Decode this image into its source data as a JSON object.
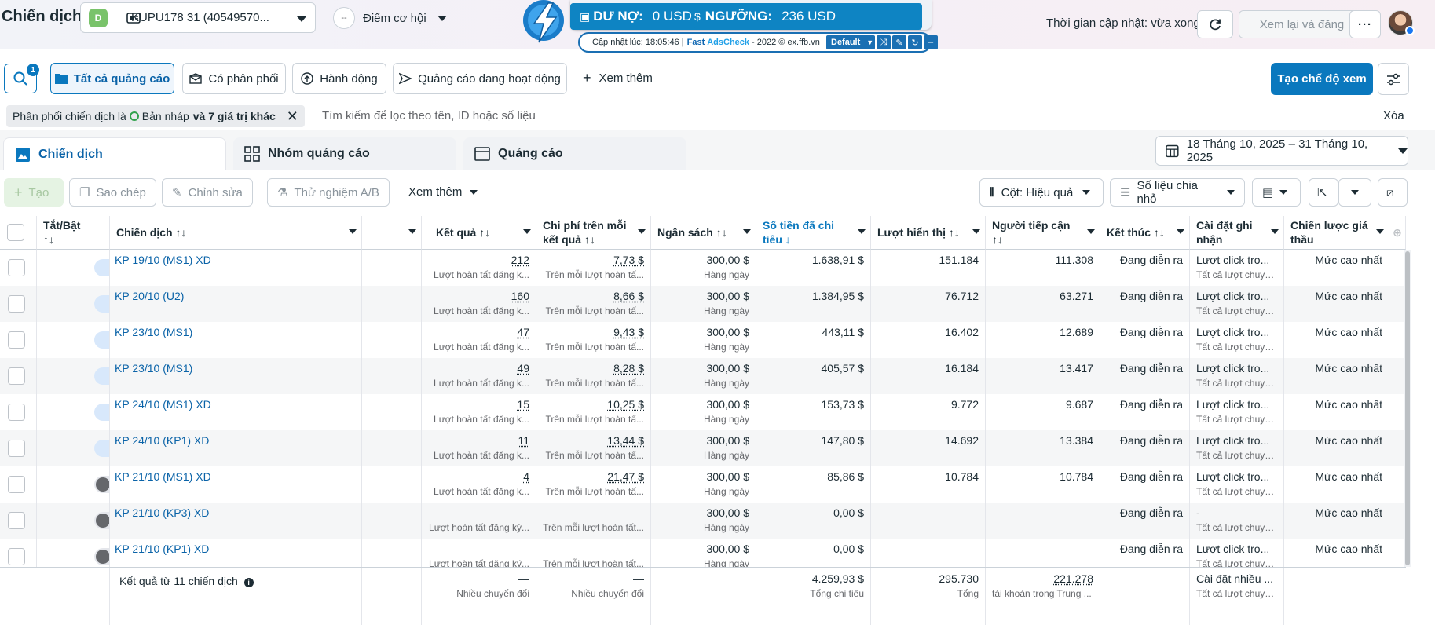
{
  "header": {
    "page_title": "Chiến dịch",
    "account_badge": "D",
    "account_name": "KUPU178 31 (40549570...",
    "opportunity_score": "--",
    "opportunity_label": "Điểm cơ hội",
    "update_status": "Thời gian cập nhật: vừa xong",
    "review_publish": "Xem lại và đăng",
    "more": "···"
  },
  "extension": {
    "debt_label": "DƯ NỢ:",
    "debt_value": "0 USD",
    "threshold_label": "NGƯỠNG:",
    "threshold_value": "236 USD",
    "updated_at": "Cập nhật lúc: 18:05:46 |",
    "brand_fast": "Fast",
    "brand_check": "AdsCheck",
    "credit": "- 2022 © ex.ffb.vn",
    "profile": "Default"
  },
  "toolbar1": {
    "search_count": "1",
    "all_ads": "Tất cả quảng cáo",
    "has_delivery": "Có phân phối",
    "actions": "Hành động",
    "active_ads": "Quảng cáo đang hoạt động",
    "see_more": "Xem thêm",
    "create_view": "Tạo chế độ xem"
  },
  "filter": {
    "chip_prefix": "Phân phối chiến dịch là",
    "chip_value": "Bản nháp",
    "chip_more": "và 7 giá trị khác",
    "search_placeholder": "Tìm kiếm để lọc theo tên, ID hoặc số liệu",
    "clear": "Xóa"
  },
  "tabs": {
    "campaigns": "Chiến dịch",
    "adsets": "Nhóm quảng cáo",
    "ads": "Quảng cáo",
    "date_range": "18 Tháng 10, 2025 – 31 Tháng 10, 2025"
  },
  "toolbar2": {
    "create": "Tạo",
    "duplicate": "Sao chép",
    "edit": "Chỉnh sửa",
    "ab_test": "Thử nghiệm A/B",
    "see_more": "Xem thêm",
    "columns": "Cột: Hiệu quả",
    "breakdown": "Số liệu chia nhỏ"
  },
  "columns": {
    "toggle": "Tắt/Bật",
    "toggle_sort": "↑↓",
    "campaign": "Chiến dịch ↑↓",
    "results": "Kết quả ↑↓",
    "cost_per_result": "Chi phí trên mỗi",
    "cost_per_result2": "kết quả ↑↓",
    "budget": "Ngân sách ↑↓",
    "spent": "Số tiền đã chi",
    "spent2": "tiêu ↓",
    "impressions": "Lượt hiển thị ↑↓",
    "reach": "Người tiếp cận",
    "reach2": "↑↓",
    "ends": "Kết thúc ↑↓",
    "attribution": "Cài đặt ghi",
    "attribution2": "nhận",
    "bid_strategy": "Chiến lược giá",
    "bid_strategy2": "thầu"
  },
  "rows": [
    {
      "on": true,
      "name": "KP 19/10 (MS1) XD",
      "results": "212",
      "results_sub": "Lượt hoàn tất đăng k...",
      "cpr": "7,73 $",
      "cpr_sub": "Trên mỗi lượt hoàn tấ...",
      "budget": "300,00 $",
      "budget_sub": "Hàng ngày",
      "spent": "1.638,91 $",
      "impr": "151.184",
      "reach": "111.308",
      "ends": "Đang diễn ra",
      "attr": "Lượt click tro...",
      "attr_sub": "Tất cả lượt chuyể...",
      "bid": "Mức cao nhất"
    },
    {
      "on": true,
      "name": "KP 20/10 (U2)",
      "results": "160",
      "results_sub": "Lượt hoàn tất đăng k...",
      "cpr": "8,66 $",
      "cpr_sub": "Trên mỗi lượt hoàn tấ...",
      "budget": "300,00 $",
      "budget_sub": "Hàng ngày",
      "spent": "1.384,95 $",
      "impr": "76.712",
      "reach": "63.271",
      "ends": "Đang diễn ra",
      "attr": "Lượt click tro...",
      "attr_sub": "Tất cả lượt chuyể...",
      "bid": "Mức cao nhất"
    },
    {
      "on": true,
      "name": "KP 23/10 (MS1)",
      "results": "47",
      "results_sub": "Lượt hoàn tất đăng k...",
      "cpr": "9,43 $",
      "cpr_sub": "Trên mỗi lượt hoàn tấ...",
      "budget": "300,00 $",
      "budget_sub": "Hàng ngày",
      "spent": "443,11 $",
      "impr": "16.402",
      "reach": "12.689",
      "ends": "Đang diễn ra",
      "attr": "Lượt click tro...",
      "attr_sub": "Tất cả lượt chuyể...",
      "bid": "Mức cao nhất"
    },
    {
      "on": true,
      "name": "KP 23/10 (MS1)",
      "results": "49",
      "results_sub": "Lượt hoàn tất đăng k...",
      "cpr": "8,28 $",
      "cpr_sub": "Trên mỗi lượt hoàn tấ...",
      "budget": "300,00 $",
      "budget_sub": "Hàng ngày",
      "spent": "405,57 $",
      "impr": "16.184",
      "reach": "13.417",
      "ends": "Đang diễn ra",
      "attr": "Lượt click tro...",
      "attr_sub": "Tất cả lượt chuyể...",
      "bid": "Mức cao nhất"
    },
    {
      "on": true,
      "name": "KP 24/10 (MS1) XD",
      "results": "15",
      "results_sub": "Lượt hoàn tất đăng k...",
      "cpr": "10,25 $",
      "cpr_sub": "Trên mỗi lượt hoàn tấ...",
      "budget": "300,00 $",
      "budget_sub": "Hàng ngày",
      "spent": "153,73 $",
      "impr": "9.772",
      "reach": "9.687",
      "ends": "Đang diễn ra",
      "attr": "Lượt click tro...",
      "attr_sub": "Tất cả lượt chuyể...",
      "bid": "Mức cao nhất"
    },
    {
      "on": true,
      "name": "KP 24/10 (KP1) XD",
      "results": "11",
      "results_sub": "Lượt hoàn tất đăng k...",
      "cpr": "13,44 $",
      "cpr_sub": "Trên mỗi lượt hoàn tấ...",
      "budget": "300,00 $",
      "budget_sub": "Hàng ngày",
      "spent": "147,80 $",
      "impr": "14.692",
      "reach": "13.384",
      "ends": "Đang diễn ra",
      "attr": "Lượt click tro...",
      "attr_sub": "Tất cả lượt chuyể...",
      "bid": "Mức cao nhất"
    },
    {
      "on": false,
      "name": "KP 21/10 (MS1) XD",
      "results": "4",
      "results_sub": "Lượt hoàn tất đăng k...",
      "cpr": "21,47 $",
      "cpr_sub": "Trên mỗi lượt hoàn tấ...",
      "budget": "300,00 $",
      "budget_sub": "Hàng ngày",
      "spent": "85,86 $",
      "impr": "10.784",
      "reach": "10.784",
      "ends": "Đang diễn ra",
      "attr": "Lượt click tro...",
      "attr_sub": "Tất cả lượt chuyể...",
      "bid": "Mức cao nhất"
    },
    {
      "on": false,
      "name": "KP 21/10 (KP3) XD",
      "results": "—",
      "results_sub": "Lượt hoàn tất đăng ký...",
      "cpr": "—",
      "cpr_sub": "Trên mỗi lượt hoàn tất...",
      "budget": "300,00 $",
      "budget_sub": "Hàng ngày",
      "spent": "0,00 $",
      "impr": "—",
      "reach": "—",
      "ends": "Đang diễn ra",
      "attr": "-",
      "attr_sub": "Tất cả lượt chuyể...",
      "bid": "Mức cao nhất"
    },
    {
      "on": false,
      "name": "KP 21/10 (KP1) XD",
      "results": "—",
      "results_sub": "Lượt hoàn tất đăng ký...",
      "cpr": "—",
      "cpr_sub": "Trên mỗi lượt hoàn tất...",
      "budget": "300,00 $",
      "budget_sub": "Hàng ngày",
      "spent": "0,00 $",
      "impr": "—",
      "reach": "—",
      "ends": "Đang diễn ra",
      "attr": "Lượt click tro...",
      "attr_sub": "Tất cả lượt chuyể...",
      "bid": "Mức cao nhất"
    }
  ],
  "footer": {
    "label": "Kết quả từ 11 chiến dịch",
    "results": "—",
    "results_sub": "Nhiều chuyển đổi",
    "cpr": "—",
    "cpr_sub": "Nhiều chuyển đổi",
    "spent": "4.259,93 $",
    "spent_sub": "Tổng chi tiêu",
    "impr": "295.730",
    "impr_sub": "Tổng",
    "reach": "221.278",
    "reach_sub": "tài khoản trong Trung ...",
    "attr": "Cài đặt nhiều ...",
    "attr_sub": "Tất cả lượt chuyể..."
  },
  "colors": {
    "accent": "#0a78be",
    "link": "#0a63a8",
    "extension_blue": "#0e84c3"
  }
}
